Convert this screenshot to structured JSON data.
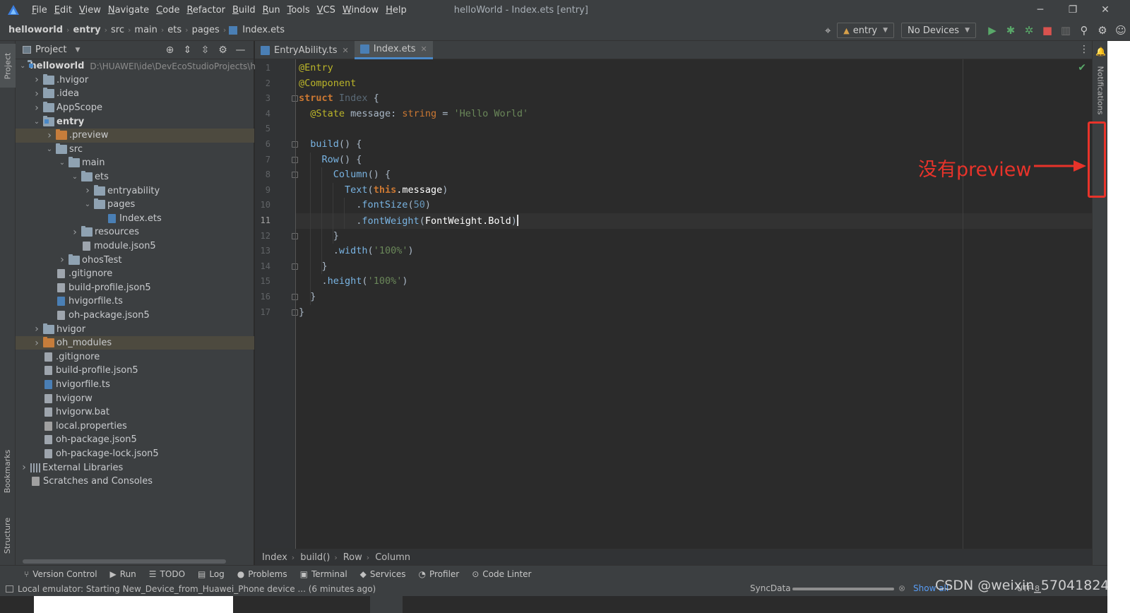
{
  "menubar": {
    "items": [
      {
        "m": "F",
        "rest": "ile"
      },
      {
        "m": "E",
        "rest": "dit"
      },
      {
        "m": "V",
        "rest": "iew"
      },
      {
        "m": "N",
        "rest": "avigate"
      },
      {
        "m": "C",
        "rest": "ode"
      },
      {
        "m": "R",
        "rest": "efactor"
      },
      {
        "m": "B",
        "rest": "uild"
      },
      {
        "m": "R",
        "rest": "un"
      },
      {
        "m": "T",
        "rest": "ools"
      },
      {
        "m": "V",
        "rest": "CS"
      },
      {
        "m": "W",
        "rest": "indow"
      },
      {
        "m": "H",
        "rest": "elp"
      }
    ],
    "window_title": "helloWorld - Index.ets [entry]",
    "minimize": "─",
    "restore": "❐",
    "close": "✕"
  },
  "navbar": {
    "breadcrumbs": [
      "helloworld",
      "entry",
      "src",
      "main",
      "ets",
      "pages",
      "Index.ets"
    ],
    "module_combo": "entry",
    "device_combo": "No Devices"
  },
  "left_strip": {
    "project": "Project",
    "bookmarks": "Bookmarks",
    "structure": "Structure"
  },
  "project": {
    "title": "Project",
    "root_label": "helloworld",
    "root_path": "D:\\HUAWEI\\ide\\DevEcoStudioProjects\\h",
    "nodes": [
      {
        "label": "helloworld",
        "depth": 0,
        "exp": "open",
        "icon": "folder-mod",
        "bold": true,
        "path": true
      },
      {
        "label": ".hvigor",
        "depth": 1,
        "exp": "closed",
        "icon": "folder"
      },
      {
        "label": ".idea",
        "depth": 1,
        "exp": "closed",
        "icon": "folder"
      },
      {
        "label": "AppScope",
        "depth": 1,
        "exp": "closed",
        "icon": "folder"
      },
      {
        "label": "entry",
        "depth": 1,
        "exp": "open",
        "icon": "folder-mod",
        "bold": true
      },
      {
        "label": ".preview",
        "depth": 2,
        "exp": "closed",
        "icon": "folder-orange",
        "hl": true
      },
      {
        "label": "src",
        "depth": 2,
        "exp": "open",
        "icon": "folder"
      },
      {
        "label": "main",
        "depth": 3,
        "exp": "open",
        "icon": "folder"
      },
      {
        "label": "ets",
        "depth": 4,
        "exp": "open",
        "icon": "folder"
      },
      {
        "label": "entryability",
        "depth": 5,
        "exp": "closed",
        "icon": "folder"
      },
      {
        "label": "pages",
        "depth": 5,
        "exp": "open",
        "icon": "folder"
      },
      {
        "label": "Index.ets",
        "depth": 6,
        "exp": "none",
        "icon": "file-ts"
      },
      {
        "label": "resources",
        "depth": 4,
        "exp": "closed",
        "icon": "folder"
      },
      {
        "label": "module.json5",
        "depth": 4,
        "exp": "none",
        "icon": "file"
      },
      {
        "label": "ohosTest",
        "depth": 3,
        "exp": "closed",
        "icon": "folder"
      },
      {
        "label": ".gitignore",
        "depth": 2,
        "exp": "none",
        "icon": "file"
      },
      {
        "label": "build-profile.json5",
        "depth": 2,
        "exp": "none",
        "icon": "file"
      },
      {
        "label": "hvigorfile.ts",
        "depth": 2,
        "exp": "none",
        "icon": "file-ts"
      },
      {
        "label": "oh-package.json5",
        "depth": 2,
        "exp": "none",
        "icon": "file"
      },
      {
        "label": "hvigor",
        "depth": 1,
        "exp": "closed",
        "icon": "folder"
      },
      {
        "label": "oh_modules",
        "depth": 1,
        "exp": "closed",
        "icon": "folder-orange",
        "hl": true
      },
      {
        "label": ".gitignore",
        "depth": 1,
        "exp": "none",
        "icon": "file"
      },
      {
        "label": "build-profile.json5",
        "depth": 1,
        "exp": "none",
        "icon": "file"
      },
      {
        "label": "hvigorfile.ts",
        "depth": 1,
        "exp": "none",
        "icon": "file-ts"
      },
      {
        "label": "hvigorw",
        "depth": 1,
        "exp": "none",
        "icon": "file"
      },
      {
        "label": "hvigorw.bat",
        "depth": 1,
        "exp": "none",
        "icon": "file"
      },
      {
        "label": "local.properties",
        "depth": 1,
        "exp": "none",
        "icon": "file-gear"
      },
      {
        "label": "oh-package.json5",
        "depth": 1,
        "exp": "none",
        "icon": "file"
      },
      {
        "label": "oh-package-lock.json5",
        "depth": 1,
        "exp": "none",
        "icon": "file"
      },
      {
        "label": "External Libraries",
        "depth": 0,
        "exp": "closed",
        "icon": "libs"
      },
      {
        "label": "Scratches and Consoles",
        "depth": 0,
        "exp": "none",
        "icon": "file-gear"
      }
    ]
  },
  "tabs": [
    {
      "label": "EntryAbility.ts",
      "active": false
    },
    {
      "label": "Index.ets",
      "active": true
    }
  ],
  "editor": {
    "current_line": 11,
    "lines": [
      [
        [
          "ann",
          "@Entry"
        ]
      ],
      [
        [
          "ann",
          "@Component"
        ]
      ],
      [
        [
          "kw",
          "struct "
        ],
        [
          "cls",
          "Index"
        ],
        [
          "",
          " {"
        ]
      ],
      [
        [
          "",
          "  "
        ],
        [
          "ann",
          "@State "
        ],
        [
          "",
          "message: "
        ],
        [
          "tp",
          "string"
        ],
        [
          "",
          " = "
        ],
        [
          "st",
          "'Hello World'"
        ]
      ],
      [],
      [
        [
          "",
          "  "
        ],
        [
          "fn",
          "build"
        ],
        [
          "",
          "() {"
        ]
      ],
      [
        [
          "",
          "    "
        ],
        [
          "fn",
          "Row"
        ],
        [
          "",
          "() {"
        ]
      ],
      [
        [
          "",
          "      "
        ],
        [
          "fn",
          "Column"
        ],
        [
          "",
          "() {"
        ]
      ],
      [
        [
          "",
          "        "
        ],
        [
          "fn",
          "Text"
        ],
        [
          "",
          "("
        ],
        [
          "kw",
          "this"
        ],
        [
          "cv",
          ".message"
        ],
        [
          "",
          ")"
        ]
      ],
      [
        [
          "",
          "          ."
        ],
        [
          "fn",
          "fontSize"
        ],
        [
          "",
          "("
        ],
        [
          "nm",
          "50"
        ],
        [
          "",
          ")"
        ]
      ],
      [
        [
          "",
          "          ."
        ],
        [
          "fn",
          "fontWeight"
        ],
        [
          "",
          "("
        ],
        [
          "cv",
          "FontWeight.Bold"
        ],
        [
          "",
          ")"
        ]
      ],
      [
        [
          "",
          "      }"
        ]
      ],
      [
        [
          "",
          "      ."
        ],
        [
          "fn",
          "width"
        ],
        [
          "",
          "("
        ],
        [
          "st",
          "'100%'"
        ],
        [
          "",
          ")"
        ]
      ],
      [
        [
          "",
          "    }"
        ]
      ],
      [
        [
          "",
          "    ."
        ],
        [
          "fn",
          "height"
        ],
        [
          "",
          "("
        ],
        [
          "st",
          "'100%'"
        ],
        [
          "",
          ")"
        ]
      ],
      [
        [
          "",
          "  }"
        ]
      ],
      [
        [
          "",
          "}"
        ]
      ]
    ]
  },
  "editor_crumbs": [
    "Index",
    "build()",
    "Row",
    "Column"
  ],
  "right_strip": {
    "notifications": "Notifications"
  },
  "annotation": {
    "text": "没有preview"
  },
  "bottom_tools": [
    {
      "icon": "git-icon",
      "glyph": "⑂",
      "label": "Version Control"
    },
    {
      "icon": "run-icon",
      "glyph": "▶",
      "label": "Run"
    },
    {
      "icon": "todo-icon",
      "glyph": "☰",
      "label": "TODO"
    },
    {
      "icon": "log-icon",
      "glyph": "▤",
      "label": "Log"
    },
    {
      "icon": "problems-icon",
      "glyph": "●",
      "label": "Problems"
    },
    {
      "icon": "terminal-icon",
      "glyph": "▣",
      "label": "Terminal"
    },
    {
      "icon": "services-icon",
      "glyph": "◆",
      "label": "Services"
    },
    {
      "icon": "profiler-icon",
      "glyph": "◔",
      "label": "Profiler"
    },
    {
      "icon": "code-linter-icon",
      "glyph": "⊙",
      "label": "Code Linter"
    }
  ],
  "status": {
    "message": "Local emulator: Starting New_Device_from_Huawei_Phone device ... (6 minutes ago)",
    "sync": "SyncData",
    "show_all": "Show all",
    "encoding": "UTF-8",
    "watermark": "CSDN @weixin_57041824"
  },
  "colors": {
    "accent": "#4a88c7",
    "annotation": "#e8332a",
    "run": "#59a869",
    "stop": "#d9534f"
  }
}
